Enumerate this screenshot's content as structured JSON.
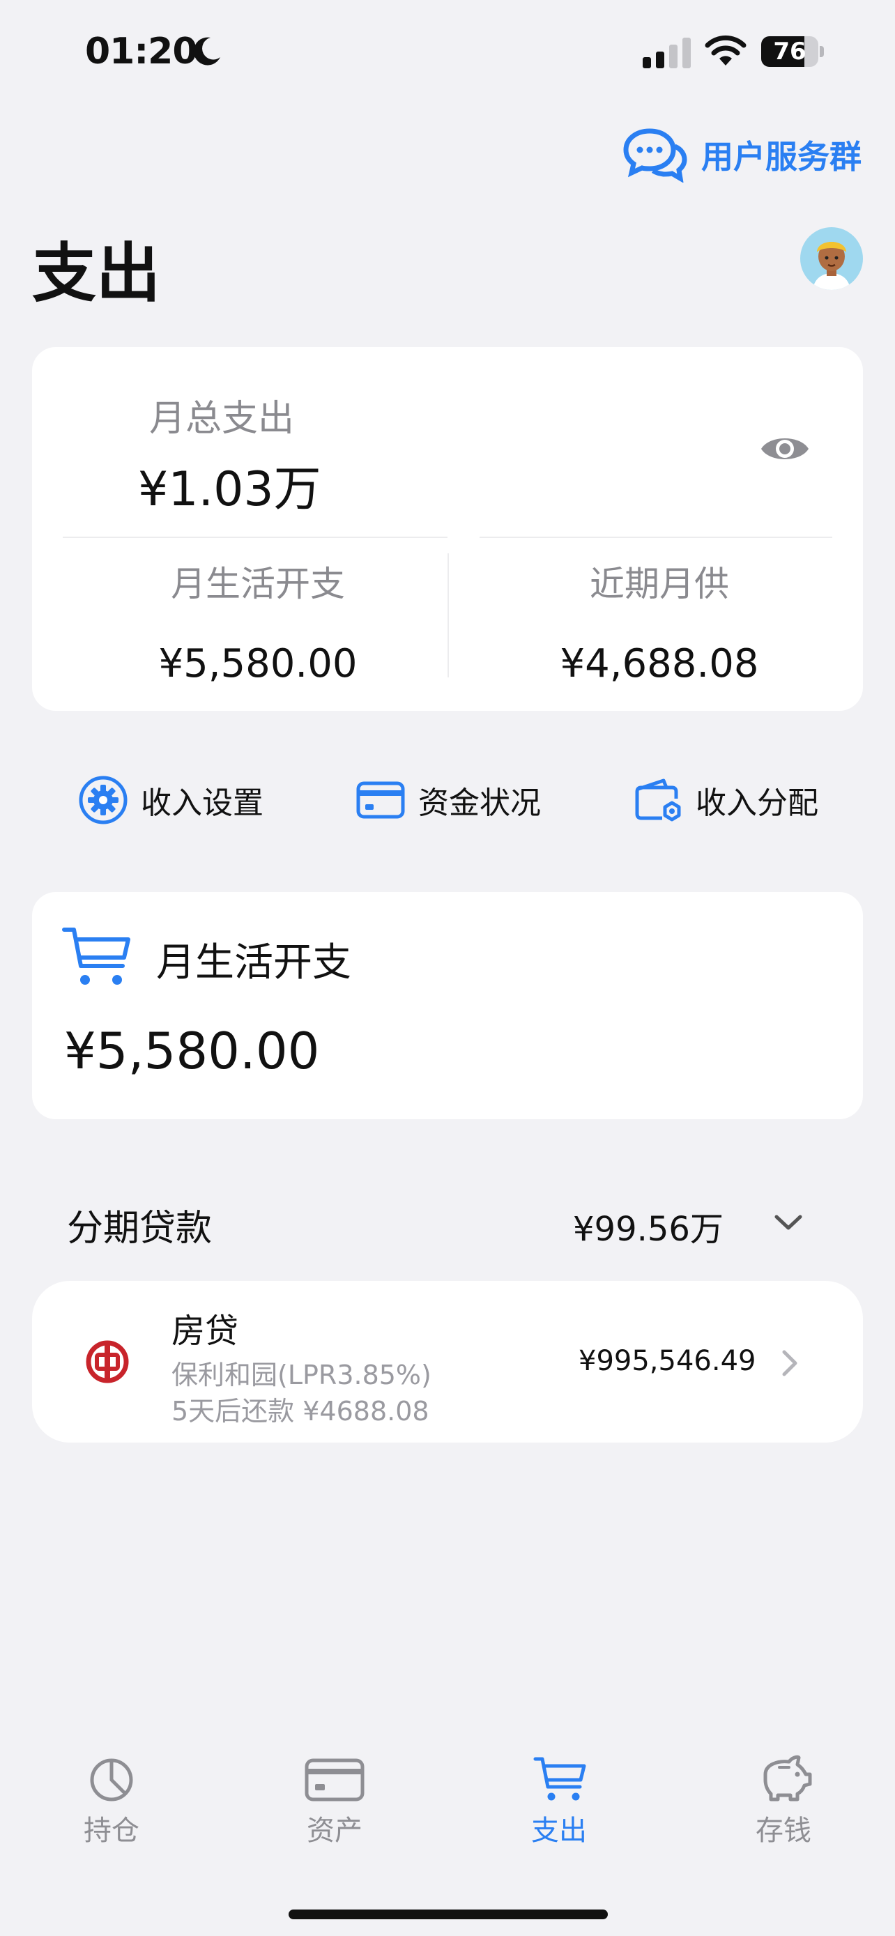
{
  "status_bar": {
    "time": "01:20",
    "battery": "76",
    "battery_level": 0.76
  },
  "header": {
    "service_group": "用户服务群",
    "title": "支出"
  },
  "summary": {
    "total_label": "月总支出",
    "total_value": "¥1.03万",
    "living_label": "月生活开支",
    "living_value": "¥5,580.00",
    "mortgage_label": "近期月供",
    "mortgage_value": "¥4,688.08"
  },
  "actions": [
    {
      "label": "收入设置",
      "icon": "gear-icon"
    },
    {
      "label": "资金状况",
      "icon": "card-icon"
    },
    {
      "label": "收入分配",
      "icon": "wallet-icon"
    }
  ],
  "living_card": {
    "label": "月生活开支",
    "value": "¥5,580.00"
  },
  "installments": {
    "title": "分期贷款",
    "total": "¥99.56万",
    "loans": [
      {
        "name": "房贷",
        "subtitle": "保利和园(LPR3.85%)",
        "due": "5天后还款 ¥4688.08",
        "amount": "¥995,546.49"
      }
    ]
  },
  "tabs": [
    {
      "label": "持仓",
      "icon": "pie-chart-icon",
      "active": false
    },
    {
      "label": "资产",
      "icon": "card-icon",
      "active": false
    },
    {
      "label": "支出",
      "icon": "cart-icon",
      "active": true
    },
    {
      "label": "存钱",
      "icon": "piggy-bank-icon",
      "active": false
    }
  ],
  "colors": {
    "accent": "#2a7ff2",
    "background": "#f2f2f5",
    "bank_red": "#c8242b"
  }
}
